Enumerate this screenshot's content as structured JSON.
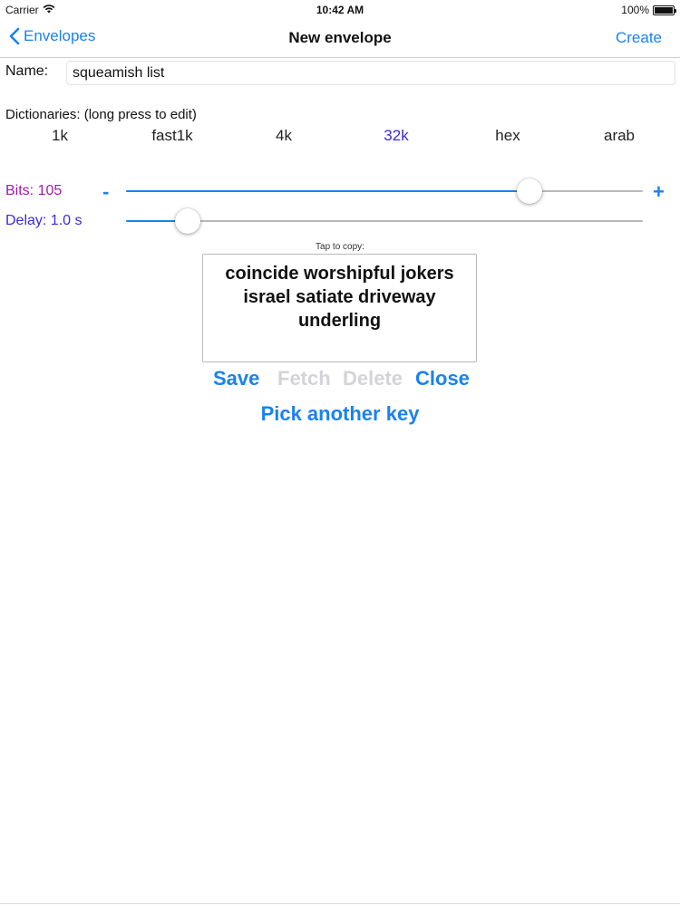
{
  "status_bar": {
    "carrier": "Carrier",
    "time": "10:42 AM",
    "battery": "100%"
  },
  "nav": {
    "back_label": "Envelopes",
    "title": "New envelope",
    "action_label": "Create"
  },
  "name": {
    "label": "Name:",
    "value": "squeamish list"
  },
  "dictionaries": {
    "label": "Dictionaries:  (long press to edit)",
    "options": [
      "1k",
      "fast1k",
      "4k",
      "32k",
      "hex",
      "arab"
    ],
    "selected": "32k"
  },
  "bits": {
    "label": "Bits: 105",
    "minus": "-",
    "plus": "+",
    "level": 0.78
  },
  "delay": {
    "label": "Delay: 1.0 s",
    "level": 0.12
  },
  "key": {
    "hint": "Tap to copy:",
    "text": "coincide worshipful jokers israel satiate driveway underling"
  },
  "actions": {
    "save": "Save",
    "fetch": "Fetch",
    "delete": "Delete",
    "close": "Close",
    "pick_another": "Pick another key"
  },
  "colors": {
    "accent": "#1a82f0",
    "bits_label": "#a21aa8",
    "delay_label": "#3a2bd6",
    "selected_dict": "#3a2bd6",
    "disabled": "#d4d4d8"
  },
  "icons": {
    "back": "chevron-left-icon",
    "wifi": "wifi-icon",
    "battery": "battery-icon"
  }
}
